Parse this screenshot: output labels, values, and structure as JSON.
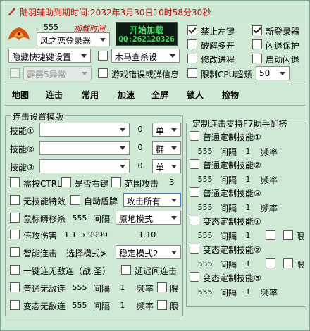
{
  "title": {
    "expire_label": "陆羽辅助到期时间:",
    "expire_value": "2032年3月30日10时58分30秒"
  },
  "top": {
    "count": "555",
    "load_time": "加载时间",
    "banner_line1": "开始加载",
    "banner_line2": "QQ:262120326",
    "login_combo": "风之恋登录器",
    "hide_hotkey_combo": "隐藏快捷键设置",
    "trojan_combo": "木马查杀设",
    "abnormal_combo": "霹雳5异常",
    "game_error_label": "游戏错误或弹信息",
    "forbid_left_label": "禁止左键",
    "new_login_label": "新登录器",
    "break_multi_label": "破解多开",
    "flashback_protect_label": "闪退保护",
    "modify_process_label": "修改进程",
    "start_flashback_label": "启动闪退",
    "limit_cpu_label": "限制CPU超频",
    "cpu_value": "50"
  },
  "menu": [
    "地图",
    "连击",
    "常用",
    "加速",
    "全屏",
    "锁人",
    "捡物"
  ],
  "combo_settings": {
    "title": "连击设置模版",
    "skills": [
      {
        "label": "技能①",
        "num": "0",
        "mode": "单"
      },
      {
        "label": "技能②",
        "num": "0",
        "mode": "群"
      },
      {
        "label": "技能③",
        "num": "0",
        "mode": "单"
      }
    ],
    "need_ctrl": "需按CTRL",
    "right_click": "是否右键",
    "range_attack": "范围攻击",
    "range_value": "3",
    "no_skill_effect": "无技能特效",
    "auto_shield": "自动盾牌",
    "attack_target": "攻击所有",
    "mouse_teleport": "鼠标瞬移杀",
    "teleport_value": "555",
    "interval": "间隔",
    "origin_mode": "原地模式",
    "double_damage": "倍攻伤害",
    "damage_range": "1.1 → 9999",
    "damage_value": "1.10",
    "smart_combo": "智能连击",
    "select_mode": "选择模式≯",
    "stable_mode": "稳定模式2",
    "one_key_combo": "一键连无敌连（战.圣）",
    "delay_combo": "延迟间连击",
    "normal_invincible": "普通无敌连",
    "ni_value1": "555",
    "ni_value2": "1",
    "freq": "频率",
    "limit": "限",
    "mutant_invincible": "变态无敌连",
    "mi_value1": "555",
    "mi_value2": "1"
  },
  "custom_combo": {
    "title": "定制连击支持F7助手配搭",
    "items": [
      {
        "label": "普通定制技能①",
        "v1": "555",
        "v2": "1"
      },
      {
        "label": "普通定制技能②",
        "v1": "555",
        "v2": "1"
      },
      {
        "label": "普通定制技能③",
        "v1": "555",
        "v2": "1"
      },
      {
        "label": "变态定制技能①",
        "v1": "555",
        "v2": "1"
      },
      {
        "label": "变态定制技能②",
        "v1": "555",
        "v2": "1"
      },
      {
        "label": "变态定制技能③",
        "v1": "555",
        "v2": "1"
      }
    ],
    "interval": "间隔",
    "freq": "频率",
    "limit": "限"
  }
}
